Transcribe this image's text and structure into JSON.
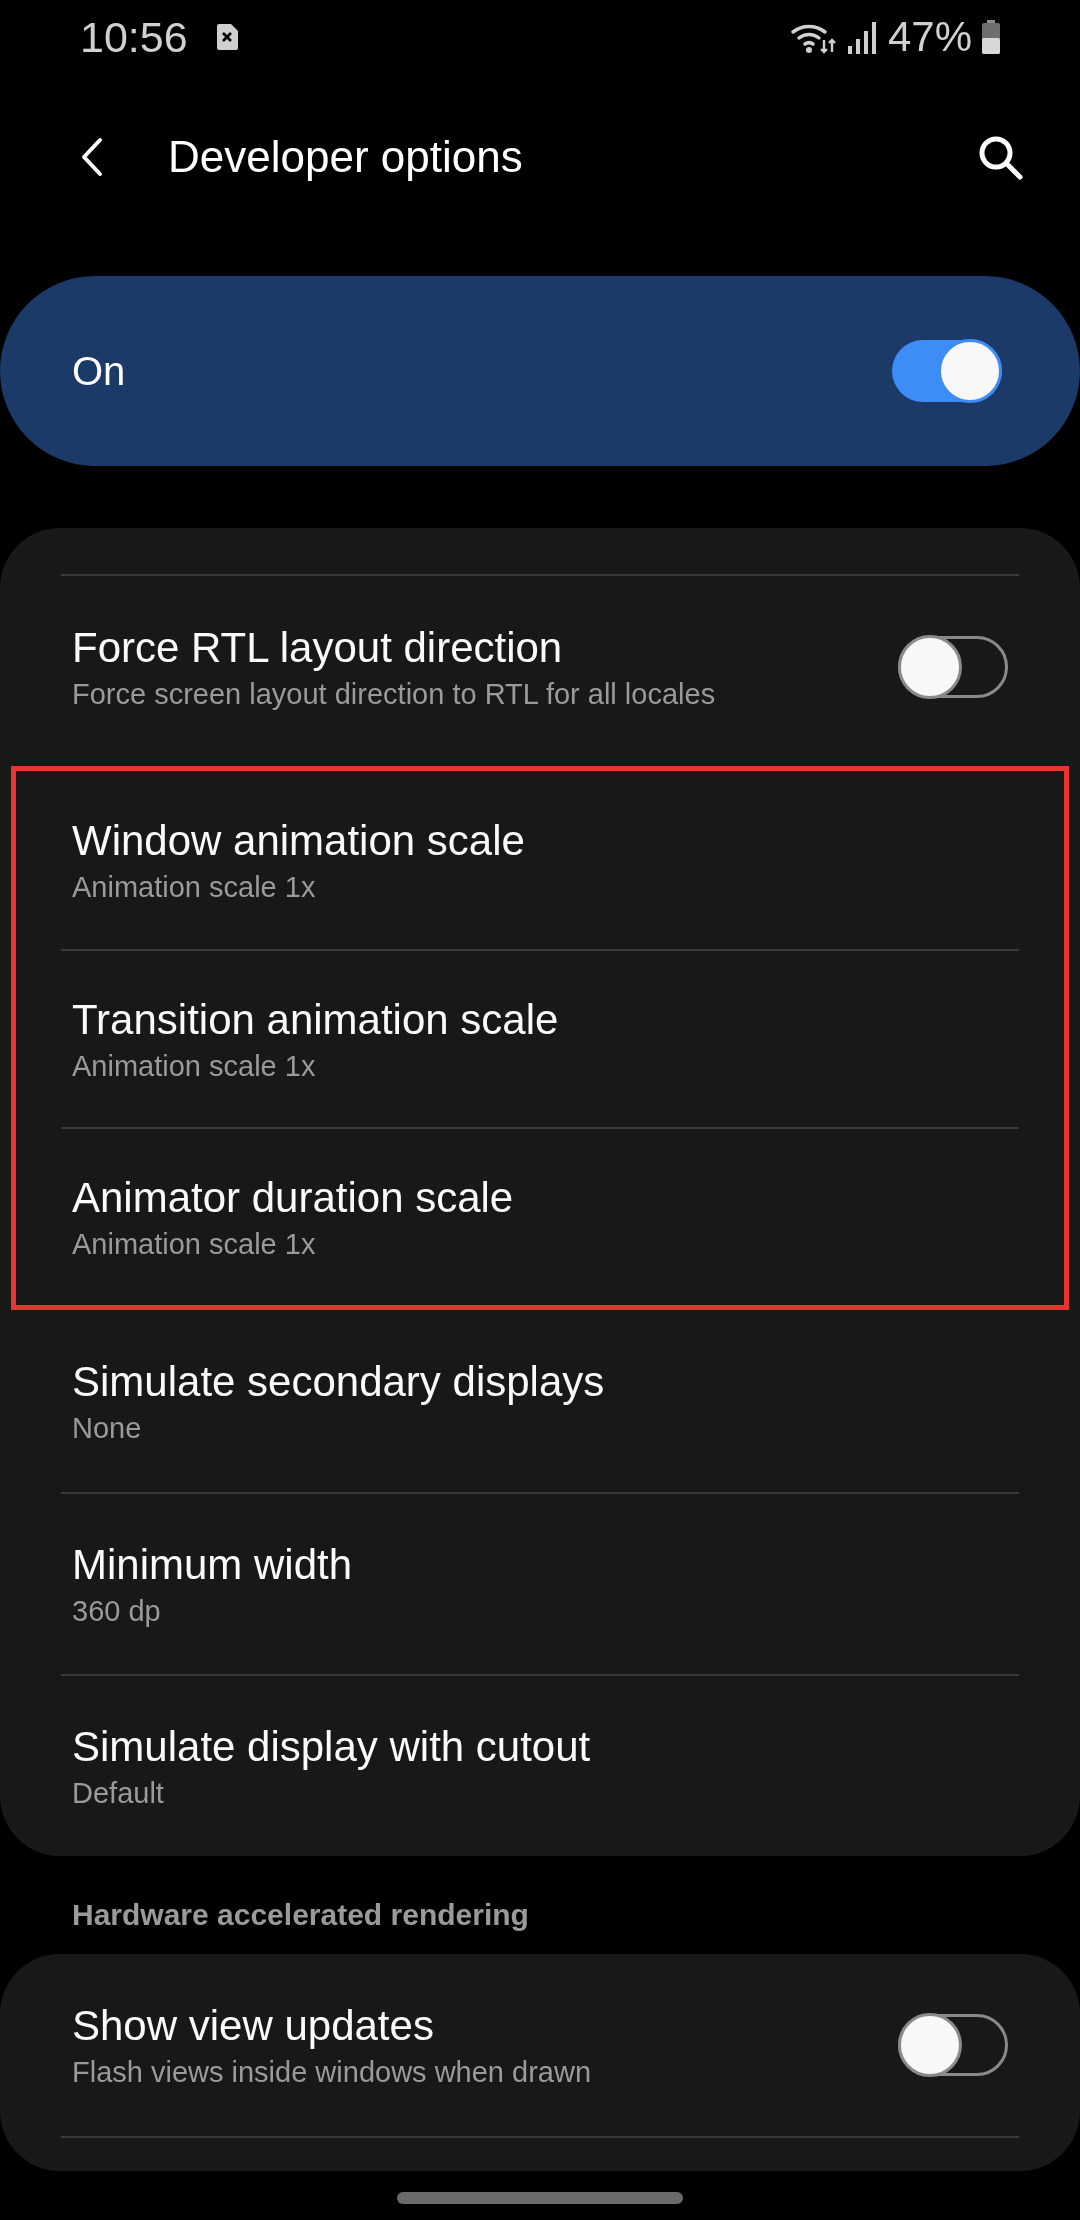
{
  "status_bar": {
    "time": "10:56",
    "battery": "47%"
  },
  "header": {
    "title": "Developer options"
  },
  "master_switch": {
    "label": "On",
    "on": true
  },
  "cards": [
    {
      "continues_above": true,
      "continues_below": false,
      "groups": [
        {
          "highlighted": false,
          "items": [
            {
              "kind": "switch",
              "title": "Force RTL layout direction",
              "subtitle": "Force screen layout direction to RTL for all locales",
              "on": false
            }
          ]
        },
        {
          "highlighted": true,
          "items": [
            {
              "kind": "option",
              "title": "Window animation scale",
              "subtitle": "Animation scale 1x"
            },
            {
              "kind": "option",
              "title": "Transition animation scale",
              "subtitle": "Animation scale 1x"
            },
            {
              "kind": "option",
              "title": "Animator duration scale",
              "subtitle": "Animation scale 1x"
            }
          ]
        },
        {
          "highlighted": false,
          "items": [
            {
              "kind": "option",
              "title": "Simulate secondary displays",
              "subtitle": "None"
            },
            {
              "kind": "option",
              "title": "Minimum width",
              "subtitle": "360 dp"
            },
            {
              "kind": "option",
              "title": "Simulate display with cutout",
              "subtitle": "Default"
            }
          ]
        }
      ]
    },
    {
      "continues_above": false,
      "continues_below": true,
      "header": "Hardware accelerated rendering",
      "groups": [
        {
          "highlighted": false,
          "items": [
            {
              "kind": "switch",
              "title": "Show view updates",
              "subtitle": "Flash views inside windows when drawn",
              "on": false
            }
          ]
        }
      ]
    }
  ]
}
